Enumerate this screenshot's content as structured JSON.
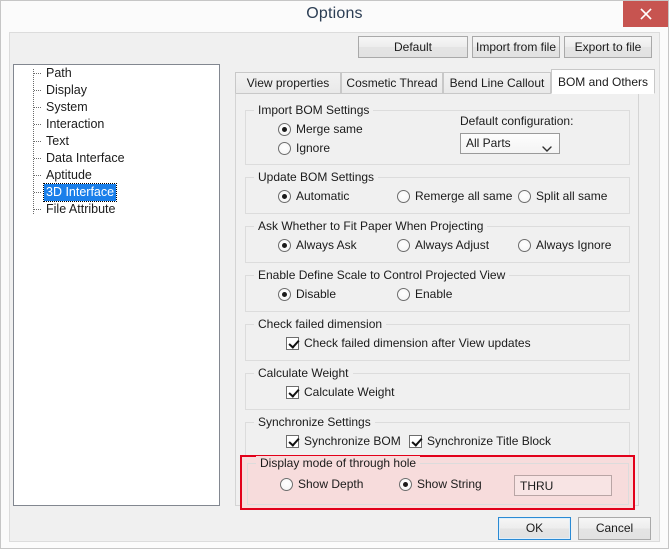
{
  "window": {
    "title": "Options",
    "close_icon": "close-x-icon"
  },
  "toolbar": {
    "default_label": "Default",
    "import_label": "Import from file",
    "export_label": "Export to file"
  },
  "sidebar": {
    "items": [
      {
        "label": "Path",
        "selected": false
      },
      {
        "label": "Display",
        "selected": false
      },
      {
        "label": "System",
        "selected": false
      },
      {
        "label": "Interaction",
        "selected": false
      },
      {
        "label": "Text",
        "selected": false
      },
      {
        "label": "Data Interface",
        "selected": false
      },
      {
        "label": "Aptitude",
        "selected": false
      },
      {
        "label": "3D Interface",
        "selected": true
      },
      {
        "label": "File Attribute",
        "selected": false
      }
    ]
  },
  "tabs": [
    {
      "label": "View properties",
      "active": false
    },
    {
      "label": "Cosmetic Thread",
      "active": false
    },
    {
      "label": "Bend Line Callout",
      "active": false
    },
    {
      "label": "BOM and Others",
      "active": true
    }
  ],
  "groups": {
    "import_bom": {
      "legend": "Import BOM Settings",
      "options": [
        {
          "label": "Merge same",
          "selected": true
        },
        {
          "label": "Ignore",
          "selected": false
        }
      ],
      "config_label": "Default configuration:",
      "config_value": "All Parts",
      "config_options": [
        "All Parts"
      ]
    },
    "update_bom": {
      "legend": "Update BOM Settings",
      "options": [
        {
          "label": "Automatic",
          "selected": true
        },
        {
          "label": "Remerge all same",
          "selected": false
        },
        {
          "label": "Split all same",
          "selected": false
        }
      ]
    },
    "fit_paper": {
      "legend": "Ask Whether to Fit Paper When Projecting",
      "options": [
        {
          "label": "Always Ask",
          "selected": true
        },
        {
          "label": "Always Adjust",
          "selected": false
        },
        {
          "label": "Always Ignore",
          "selected": false
        }
      ]
    },
    "define_scale": {
      "legend": "Enable Define Scale to Control Projected View",
      "options": [
        {
          "label": "Disable",
          "selected": true
        },
        {
          "label": "Enable",
          "selected": false
        }
      ]
    },
    "check_dimension": {
      "legend": "Check failed dimension",
      "checkboxes": [
        {
          "label": "Check failed dimension after View updates",
          "checked": true
        }
      ]
    },
    "calculate_weight": {
      "legend": "Calculate Weight",
      "checkboxes": [
        {
          "label": "Calculate Weight",
          "checked": true
        }
      ]
    },
    "synchronize": {
      "legend": "Synchronize Settings",
      "checkboxes": [
        {
          "label": "Synchronize BOM",
          "checked": true
        },
        {
          "label": "Synchronize Title Block",
          "checked": true
        }
      ]
    },
    "through_hole": {
      "legend": "Display mode of through hole",
      "highlighted": true,
      "highlight_color": "#e2001a",
      "highlight_fill": "#f7dcdc",
      "options": [
        {
          "label": "Show Depth",
          "selected": false
        },
        {
          "label": "Show String",
          "selected": true
        }
      ],
      "text_value": "THRU",
      "text_placeholder": ""
    }
  },
  "footer": {
    "ok_label": "OK",
    "cancel_label": "Cancel"
  }
}
